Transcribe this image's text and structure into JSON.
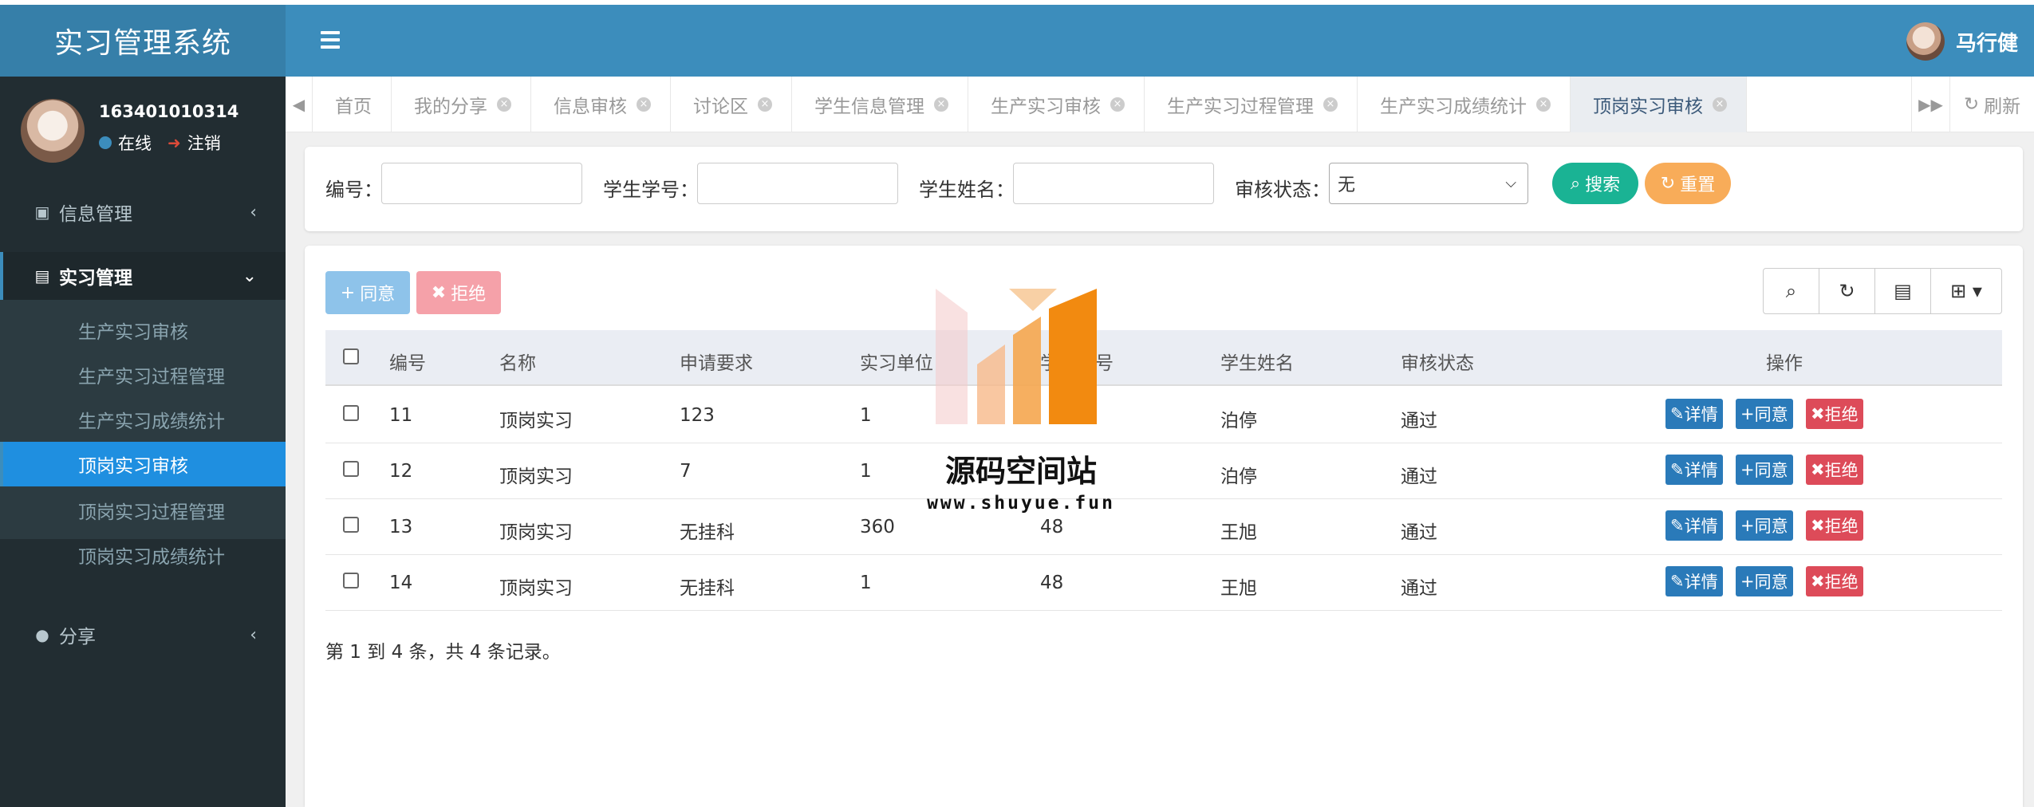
{
  "app": {
    "title": "实习管理系统"
  },
  "header": {
    "user_name": "马行健"
  },
  "sidebar": {
    "user_id": "163401010314",
    "status": "在线",
    "logout": "注销",
    "menu": [
      {
        "label": "信息管理",
        "icon": "contact-book-icon"
      },
      {
        "label": "实习管理",
        "icon": "id-card-icon"
      },
      {
        "label": "分享",
        "icon": "comment-icon"
      }
    ],
    "submenu": [
      {
        "label": "生产实习审核"
      },
      {
        "label": "生产实习过程管理"
      },
      {
        "label": "生产实习成绩统计"
      },
      {
        "label": "顶岗实习审核"
      },
      {
        "label": "顶岗实习过程管理"
      },
      {
        "label": "顶岗实习成绩统计"
      }
    ]
  },
  "tabs": [
    {
      "label": "首页"
    },
    {
      "label": "我的分享"
    },
    {
      "label": "信息审核"
    },
    {
      "label": "讨论区"
    },
    {
      "label": "学生信息管理"
    },
    {
      "label": "生产实习审核"
    },
    {
      "label": "生产实习过程管理"
    },
    {
      "label": "生产实习成绩统计"
    },
    {
      "label": "顶岗实习审核"
    }
  ],
  "tabs_refresh": "刷新",
  "search": {
    "id_label": "编号：",
    "student_no_label": "学生学号：",
    "student_name_label": "学生姓名：",
    "status_label": "审核状态：",
    "status_value": "无",
    "search_button": "搜索",
    "reset_button": "重置"
  },
  "toolbar": {
    "agree": "同意",
    "reject": "拒绝"
  },
  "table": {
    "headers": [
      "编号",
      "名称",
      "申请要求",
      "实习单位",
      "学生学号",
      "学生姓名",
      "审核状态",
      "操作"
    ],
    "rows": [
      {
        "id": "11",
        "name": "顶岗实习",
        "req": "123",
        "unit": "1",
        "student_no": "",
        "student_name": "泊停",
        "status": "通过"
      },
      {
        "id": "12",
        "name": "顶岗实习",
        "req": "7",
        "unit": "1",
        "student_no": "",
        "student_name": "泊停",
        "status": "通过"
      },
      {
        "id": "13",
        "name": "顶岗实习",
        "req": "无挂科",
        "unit": "360",
        "student_no": "48",
        "student_name": "王旭",
        "status": "通过"
      },
      {
        "id": "14",
        "name": "顶岗实习",
        "req": "无挂科",
        "unit": "1",
        "student_no": "48",
        "student_name": "王旭",
        "status": "通过"
      }
    ],
    "action_detail": "详情",
    "action_agree": "同意",
    "action_reject": "拒绝"
  },
  "records_summary": "第 1 到 4 条，共 4 条记录。",
  "watermark": {
    "title": "源码空间站",
    "url": "www.shuyue.fun"
  },
  "colors": {
    "header": "#3c8dbc",
    "logo": "#367fa9",
    "sidebar": "#222d32",
    "active_item": "#1f8fe0",
    "search": "#1ab394",
    "reset": "#f8ac59",
    "danger": "#dd4b59"
  }
}
